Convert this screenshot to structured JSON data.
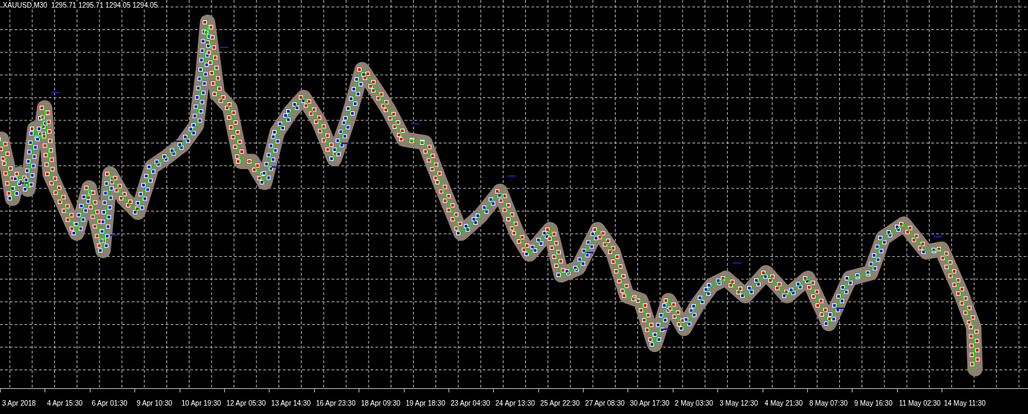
{
  "chart": {
    "title": "XAUUSD,M30  1295.71 1295.71 1294.05 1294.05",
    "time_axis_labels": [
      "3 Apr 2018",
      "4 Apr 15:30",
      "6 Apr 01:30",
      "9 Apr 10:30",
      "10 Apr 19:30",
      "12 Apr 05:30",
      "13 Apr 14:30",
      "16 Apr 23:30",
      "18 Apr 09:30",
      "19 Apr 18:30",
      "23 Apr 04:30",
      "24 Apr 13:30",
      "25 Apr 22:30",
      "27 Apr 08:30",
      "30 Apr 17:30",
      "2 May 03:30",
      "3 May 12:30",
      "4 May 21:30",
      "8 May 07:30",
      "9 May 16:30",
      "11 May 02:30",
      "14 May 11:30"
    ]
  }
}
